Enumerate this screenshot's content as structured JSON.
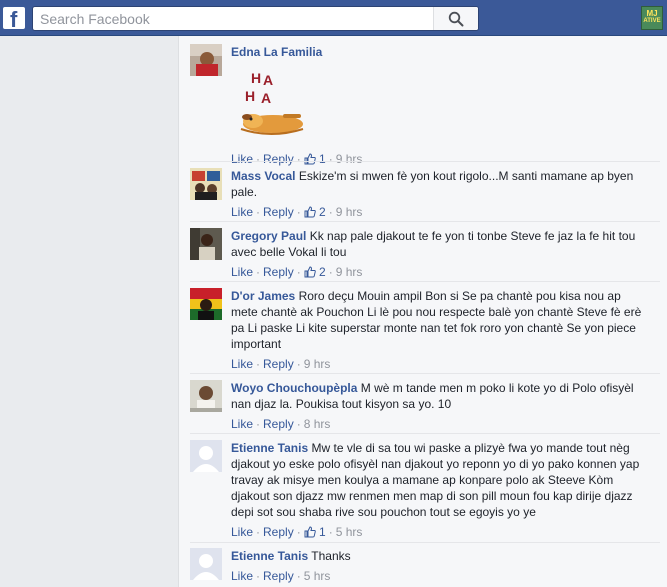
{
  "search": {
    "placeholder": "Search Facebook"
  },
  "badge": {
    "line1": "MJ",
    "line2": "ATIVE"
  },
  "comment_actions": {
    "like": "Like",
    "reply": "Reply",
    "sep": "·"
  },
  "sticker": {
    "letters": [
      "H",
      "A",
      "H",
      "A"
    ]
  },
  "comments": [
    {
      "author": "Edna La Familia",
      "text": "",
      "likes": "1",
      "time": "9 hrs"
    },
    {
      "author": "Mass Vocal",
      "text": "Eskize'm si mwen fè yon kout rigolo...M santi mamane ap byen pale.",
      "likes": "2",
      "time": "9 hrs"
    },
    {
      "author": "Gregory Paul",
      "text": "Kk nap pale djakout te fe yon ti tonbe Steve fe jaz la fe hit tou avec belle Vokal li tou",
      "likes": "2",
      "time": "9 hrs"
    },
    {
      "author": "D'or James",
      "text": "Roro deçu Mouin ampil Bon si Se pa chantè pou kisa nou ap mete chantè ak Pouchon Li lè pou nou respecte balè yon chantè Steve fè erè pa Li paske Li kite superstar monte nan tet fok roro yon chantè Se yon piece important",
      "likes": "",
      "time": "9 hrs"
    },
    {
      "author": "Woyo Chouchoupèpla",
      "text": "M wè m tande men m poko li kote yo di Polo ofisyèl nan djaz la. Poukisa tout kisyon sa yo. 10",
      "likes": "",
      "time": "8 hrs"
    },
    {
      "author": "Etienne Tanis",
      "text": "Mw te vle di sa tou wi paske a plizyè fwa yo mande tout nèg djakout yo eske polo ofisyèl nan djakout yo reponn yo di yo pako konnen yap travay ak misye men koulya a mamane ap konpare polo ak Steeve Kòm djakout son djazz mw renmen men map di son pill moun fou kap dirije djazz depi sot sou shaba rive sou pouchon tout se egoyis yo ye",
      "likes": "1",
      "time": "5 hrs"
    },
    {
      "author": "Etienne Tanis",
      "text": "Thanks",
      "likes": "",
      "time": "5 hrs"
    }
  ],
  "colors": {
    "fb_blue": "#3b5998",
    "link": "#365899",
    "meta": "#90949c",
    "bg": "#e9ebee",
    "panel": "#f6f7f9"
  }
}
